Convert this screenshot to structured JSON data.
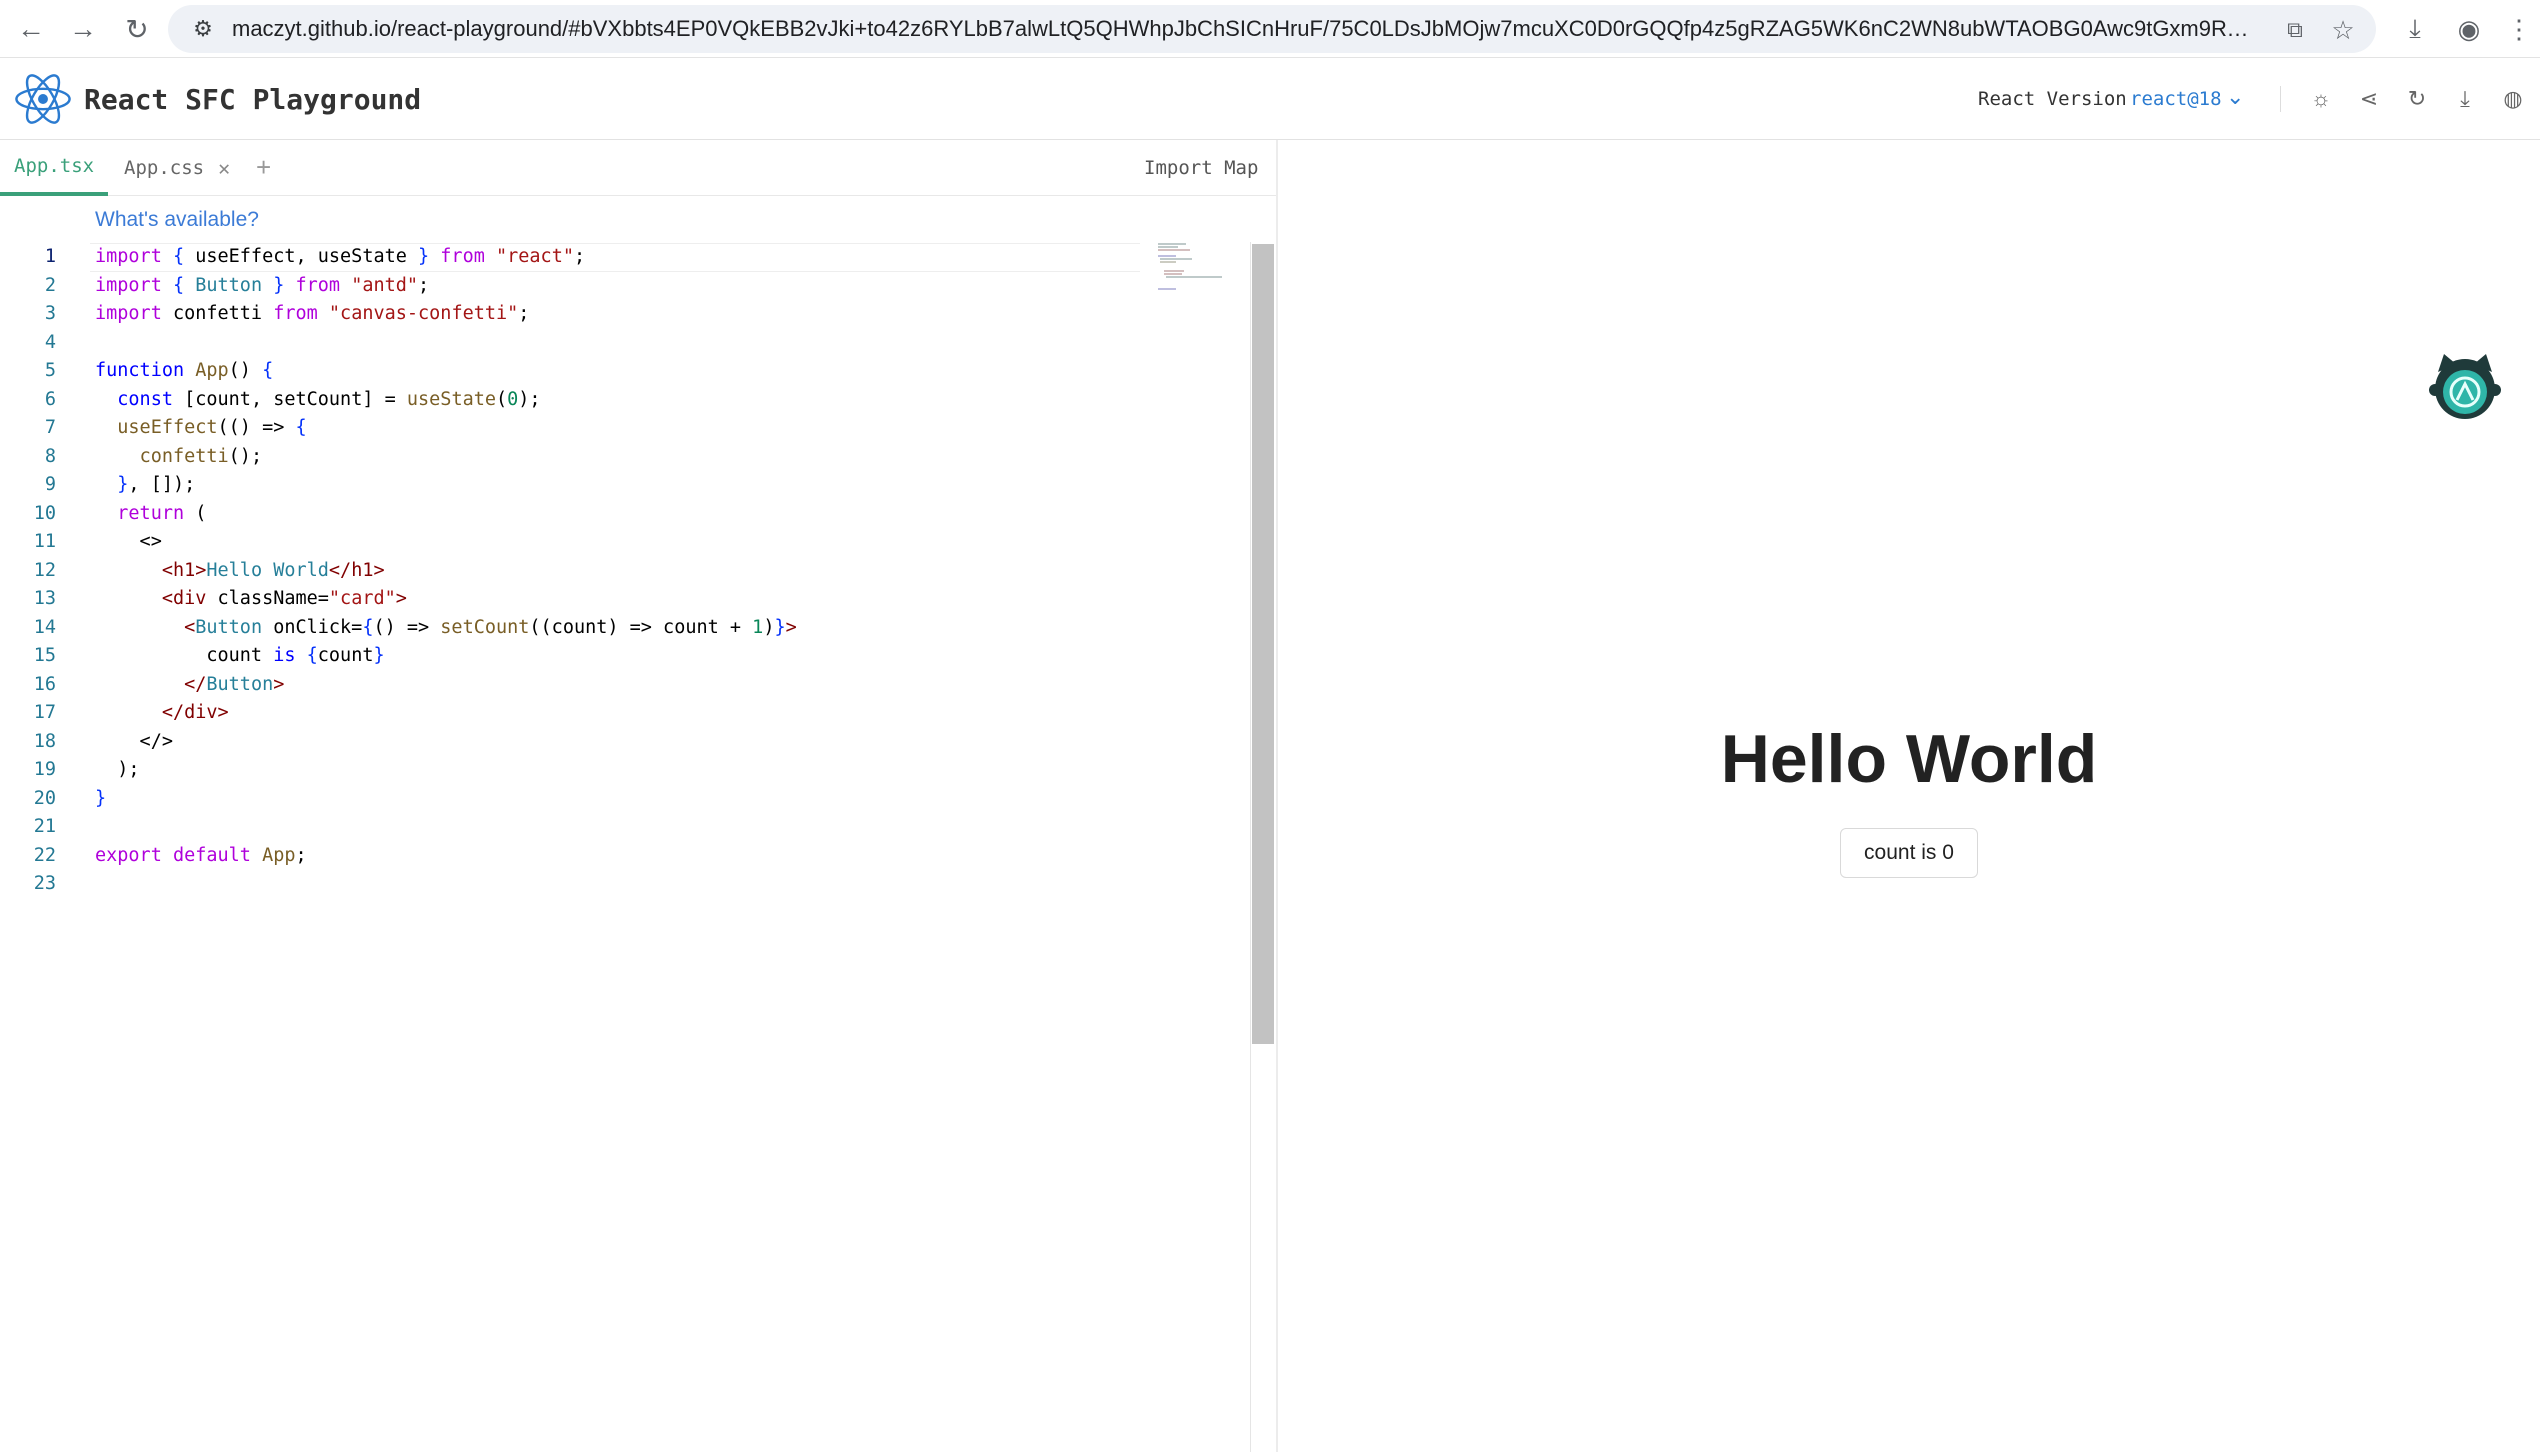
{
  "browser": {
    "url": "maczyt.github.io/react-playground/#bVXbbts4EP0VQkEBB2vJki+to42z6RYLbB7alwLtQ5QHWhpJbChSICnHruF/75C0LDsJbMOjw7mcuXC0D0rGQQfp4z5gRZAG5WK6nC2WN8ubWTAOBG0Awc9tGxm9RY..."
  },
  "header": {
    "title": "React SFC Playground",
    "version_label": "React Version",
    "version_value": "react@18"
  },
  "editor": {
    "tabs": [
      {
        "label": "App.tsx",
        "active": true
      },
      {
        "label": "App.css",
        "active": false
      }
    ],
    "add_tab": "+",
    "import_map": "Import Map",
    "whats_available": "What's available?",
    "line_numbers": [
      "1",
      "2",
      "3",
      "4",
      "5",
      "6",
      "7",
      "8",
      "9",
      "10",
      "11",
      "12",
      "13",
      "14",
      "15",
      "16",
      "17",
      "18",
      "19",
      "20",
      "21",
      "22",
      "23"
    ]
  },
  "preview": {
    "heading": "Hello World",
    "button_label": "count is 0"
  },
  "colors": {
    "accent": "#3aa07a",
    "link": "#3c7bd6",
    "react_blue": "#2b7bd0"
  }
}
